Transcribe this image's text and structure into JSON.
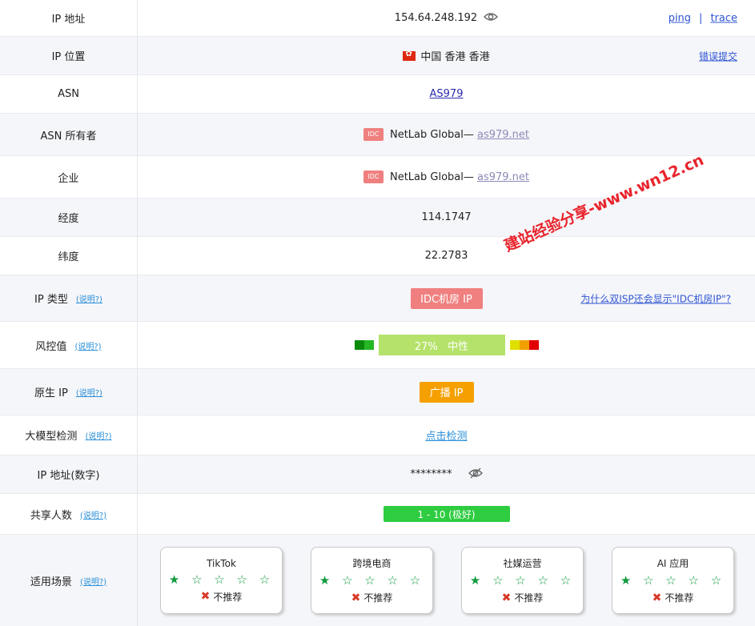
{
  "rows": {
    "ip": {
      "label": "IP 地址",
      "value": "154.64.248.192",
      "links": [
        "ping",
        "trace"
      ],
      "sep": "|"
    },
    "location": {
      "label": "IP 位置",
      "value": "中国 香港 香港",
      "link": "错误提交"
    },
    "asn": {
      "label": "ASN",
      "value": "AS979"
    },
    "asn_owner": {
      "label": "ASN 所有者",
      "tag": "IDC",
      "value": "NetLab Global— ",
      "domain": "as979.net"
    },
    "company": {
      "label": "企业",
      "tag": "IDC",
      "value": "NetLab Global— ",
      "domain": "as979.net"
    },
    "longitude": {
      "label": "经度",
      "value": "114.1747"
    },
    "latitude": {
      "label": "纬度",
      "value": "22.2783"
    },
    "ip_type": {
      "label": "IP 类型",
      "help": "(说明?)",
      "badge": "IDC机房 IP",
      "link": "为什么双ISP还会显示\"IDC机房IP\"?"
    },
    "risk": {
      "label": "风控值",
      "help": "(说明?)",
      "value": "27%   中性",
      "percent": 27
    },
    "native": {
      "label": "原生 IP",
      "help": "(说明?)",
      "badge": "广播 IP"
    },
    "llm": {
      "label": "大模型检测",
      "help": "(说明?)",
      "link": "点击检测"
    },
    "ip_numeric": {
      "label": "IP 地址(数字)",
      "value": "********"
    },
    "shared": {
      "label": "共享人数",
      "help": "(说明?)",
      "badge": "1 - 10 (极好)"
    },
    "scenes": {
      "label": "适用场景",
      "help": "(说明?)",
      "cards": [
        {
          "name": "TikTok",
          "stars_full": "★",
          "stars_empty": "☆ ☆ ☆ ☆",
          "rec": "不推荐"
        },
        {
          "name": "跨境电商",
          "stars_full": "★",
          "stars_empty": "☆ ☆ ☆ ☆",
          "rec": "不推荐"
        },
        {
          "name": "社媒运营",
          "stars_full": "★",
          "stars_empty": "☆ ☆ ☆ ☆",
          "rec": "不推荐"
        },
        {
          "name": "AI 应用",
          "stars_full": "★",
          "stars_empty": "☆ ☆ ☆ ☆",
          "rec": "不推荐"
        }
      ]
    }
  },
  "watermark": "建站经验分享-www.wn12.cn",
  "colors": {
    "idc_badge": "#f08080",
    "broadcast_badge": "#f5a000",
    "shared_badge": "#2ecc40",
    "risk_bar": "#b5e26a",
    "link": "#2f55d4",
    "help": "#2a8fd8",
    "watermark": "#e8242c"
  },
  "icons": {
    "view": "eye-icon",
    "hidden": "eye-off-icon",
    "flag": "hong-kong-flag-icon",
    "reject": "x-mark-icon",
    "star": "star-icon"
  }
}
